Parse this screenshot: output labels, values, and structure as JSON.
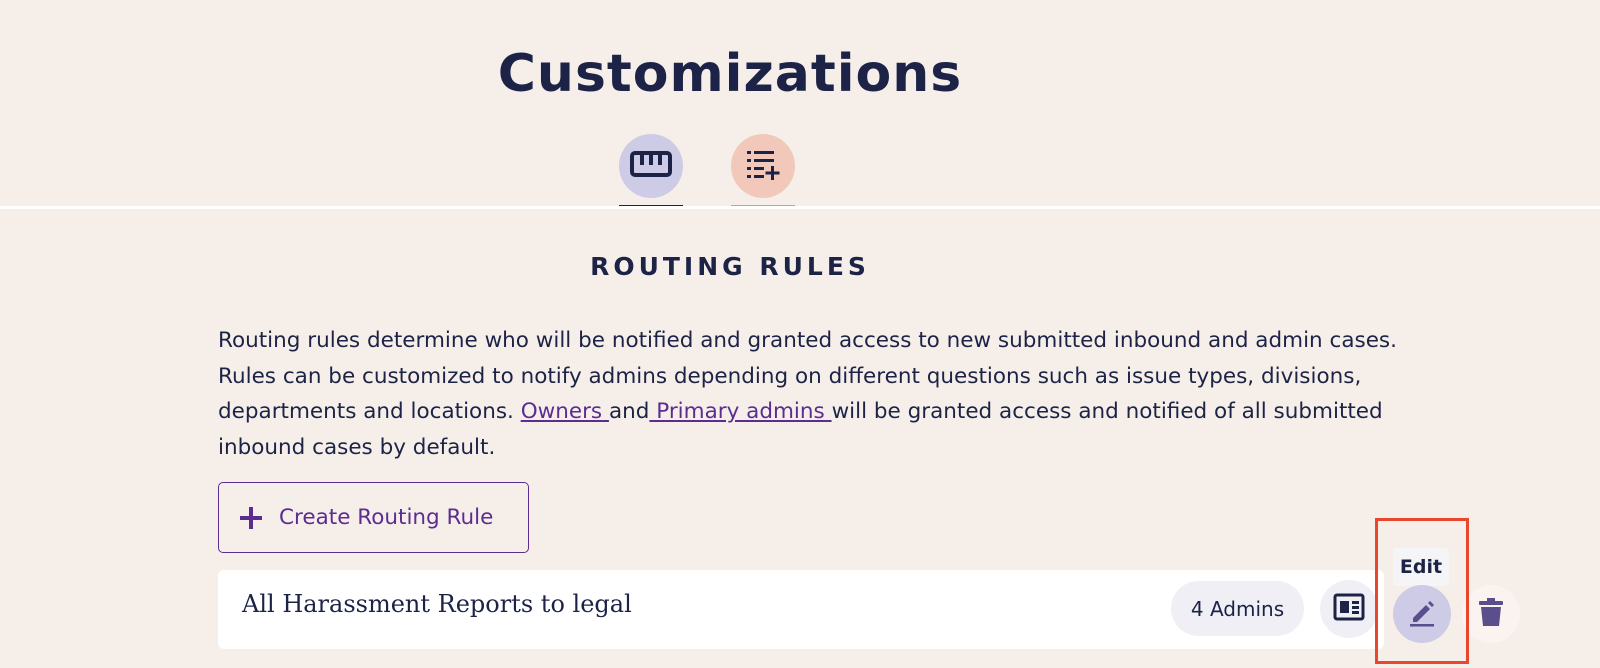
{
  "page": {
    "title": "Customizations"
  },
  "tabs": [
    {
      "icon": "ruler-icon",
      "accent": "#1c2346",
      "background": "#cdcbe5"
    },
    {
      "icon": "playlist-add-icon",
      "accent": "#e29683",
      "background": "#f1c8b9"
    }
  ],
  "section": {
    "heading": "ROUTING RULES",
    "description_part1": "Routing rules determine who will be notified and granted access to new submitted inbound and admin cases. Rules can be customized to notify admins depending on different questions such as issue types, divisions, departments and locations. ",
    "owners_link": "Owners ",
    "and_text": "and",
    "primary_admins_link": " Primary admins ",
    "description_part2": "will be granted access and notified of all submitted inbound cases by default."
  },
  "create_button": {
    "label": "Create Routing Rule",
    "icon": "plus-icon"
  },
  "rules": [
    {
      "name": "All Harassment Reports to legal",
      "admins_label": "4 Admins",
      "actions": [
        "details-icon",
        "edit-icon",
        "delete-icon"
      ]
    }
  ],
  "tooltip": {
    "text": "Edit"
  },
  "colors": {
    "background": "#f6efe9",
    "text": "#1c2346",
    "link": "#5b2d91",
    "highlight": "#e8472e"
  }
}
